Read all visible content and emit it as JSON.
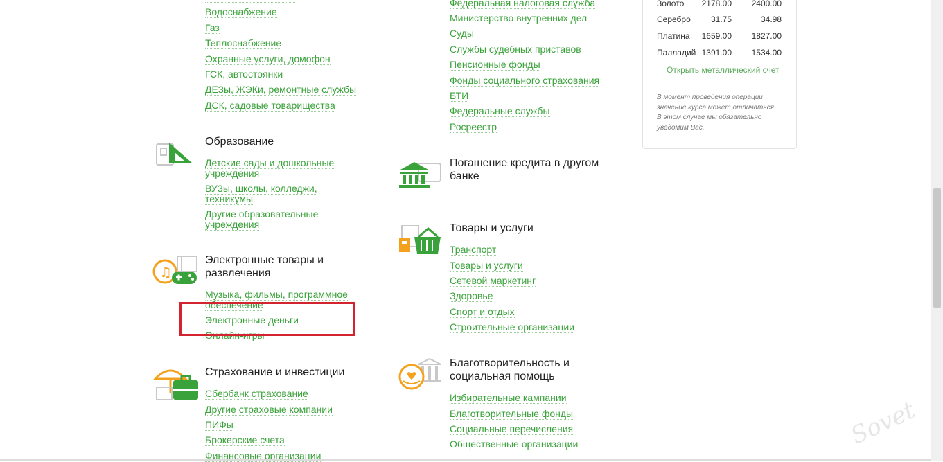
{
  "col1": {
    "top_links": [
      "Водоснабжение",
      "Газ",
      "Теплоснабжение",
      "Охранные услуги, домофон",
      "ГСК, автостоянки",
      "ДЕЗы, ЖЭКи, ремонтные службы",
      "ДСК, садовые товарищества"
    ],
    "education": {
      "title": "Образование",
      "links": [
        "Детские сады и дошкольные учреждения",
        "ВУЗы, школы, колледжи, техникумы",
        "Другие образовательные учреждения"
      ]
    },
    "electronic": {
      "title": "Электронные товары и развлечения",
      "links": [
        "Музыка, фильмы, программное обеспечение",
        "Электронные деньги",
        "Онлайн-игры"
      ]
    },
    "insurance": {
      "title": "Страхование и инвестиции",
      "links": [
        "Сбербанк страхование",
        "Другие страховые компании",
        "ПИФы",
        "Брокерские счета",
        "Финансовые организации"
      ]
    }
  },
  "col2": {
    "top_links": [
      "Федеральная налоговая служба",
      "Министерство внутренних дел",
      "Суды",
      "Службы судебных приставов",
      "Пенсионные фонды",
      "Фонды социального страхования",
      "БТИ",
      "Федеральные службы",
      "Росреестр"
    ],
    "credit": {
      "title": "Погашение кредита в другом банке"
    },
    "goods": {
      "title": "Товары и услуги",
      "links": [
        "Транспорт",
        "Товары и услуги",
        "Сетевой маркетинг",
        "Здоровье",
        "Спорт и отдых",
        "Строительные организации"
      ]
    },
    "charity": {
      "title": "Благотворительность и социальная помощь",
      "links": [
        "Избирательные кампании",
        "Благотворительные фонды",
        "Социальные перечисления",
        "Общественные организации"
      ]
    }
  },
  "metals": {
    "rows": [
      {
        "name": "Золото",
        "buy": "2178.00",
        "sell": "2400.00"
      },
      {
        "name": "Серебро",
        "buy": "31.75",
        "sell": "34.98"
      },
      {
        "name": "Платина",
        "buy": "1659.00",
        "sell": "1827.00"
      },
      {
        "name": "Палладий",
        "buy": "1391.00",
        "sell": "1534.00"
      }
    ],
    "open_link": "Открыть металлический счет",
    "note": "В момент проведения операции значение курса может отличаться. В этом случае мы обязательно уведомим Вас."
  },
  "colors": {
    "link": "#3aa23a",
    "accent_green": "#21a038",
    "orange": "#f4a21d",
    "highlight": "#d3232f"
  }
}
